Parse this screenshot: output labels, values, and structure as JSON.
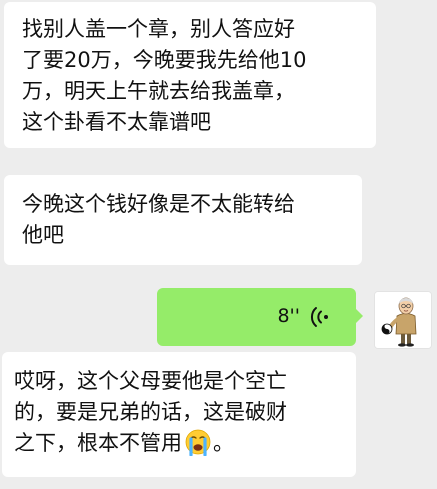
{
  "messages": [
    {
      "side": "left",
      "lines": [
        "找别人盖一个章，别人答应好",
        "了要20万，今晚要我先给他10",
        "万，明天上午就去给我盖章，",
        "这个卦看不太靠谱吧"
      ]
    },
    {
      "side": "left",
      "lines": [
        "今晚这个钱好像是不太能转给",
        "他吧"
      ]
    },
    {
      "side": "right",
      "type": "voice",
      "duration": "8''",
      "icon": "voice-wave-icon"
    },
    {
      "side": "left",
      "lines": [
        "哎呀，这个父母要他是个空亡",
        "的，要是兄弟的话，这是破财",
        "之下，根本不管用"
      ],
      "trailing_emoji": "crying-face-emoji",
      "trailing_text": "。"
    }
  ],
  "avatar": {
    "icon": "cartoon-man-with-yin-yang-avatar"
  },
  "colors": {
    "background": "#ededed",
    "incoming_bubble": "#ffffff",
    "outgoing_bubble": "#95ec69"
  }
}
